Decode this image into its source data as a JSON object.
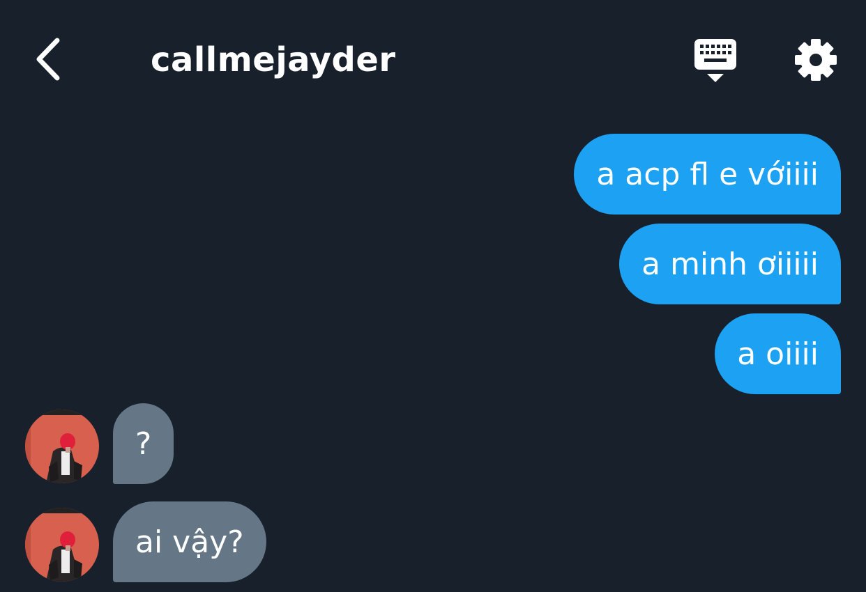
{
  "header": {
    "title": "callmejayder",
    "back_icon": "chevron-left-icon",
    "keyboard_icon": "keyboard-icon",
    "settings_icon": "gear-icon"
  },
  "messages": [
    {
      "direction": "outgoing",
      "text": "a acp fl e vớiiii"
    },
    {
      "direction": "outgoing",
      "text": "a minh ơiiiii"
    },
    {
      "direction": "outgoing",
      "text": "a oiiii"
    },
    {
      "direction": "incoming",
      "text": "?"
    },
    {
      "direction": "incoming",
      "text": "ai vậy?"
    }
  ],
  "colors": {
    "background": "#17202b",
    "outgoing_bubble": "#1da1f2",
    "incoming_bubble": "#657786",
    "text": "#ffffff",
    "avatar_background": "#d7604f"
  }
}
